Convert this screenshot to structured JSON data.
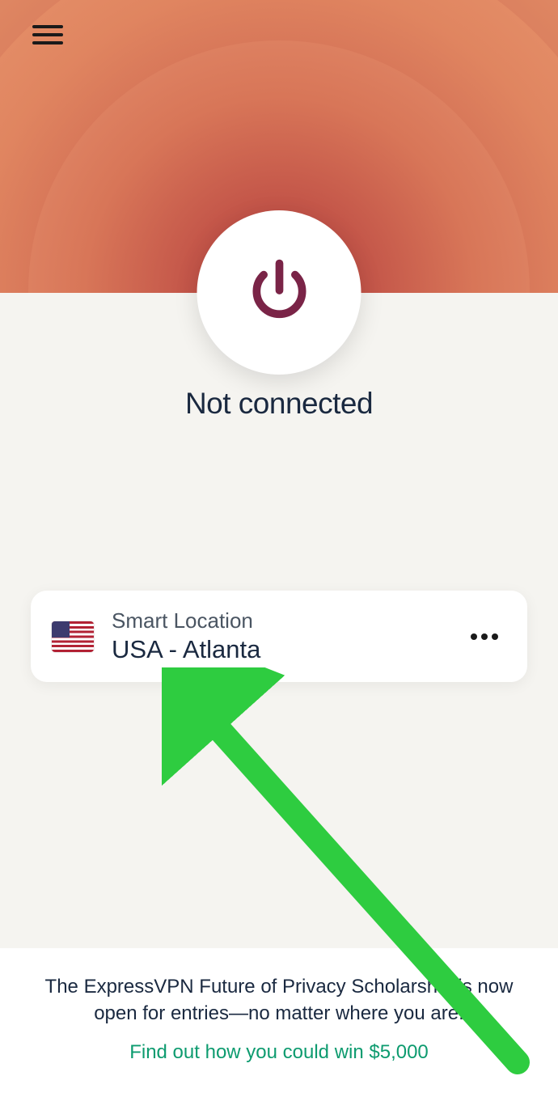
{
  "status": {
    "text": "Not connected"
  },
  "location": {
    "label": "Smart Location",
    "name": "USA - Atlanta",
    "flag_country": "usa"
  },
  "footer": {
    "message": "The ExpressVPN Future of Privacy Scholarship is now open for entries—no matter where you are.",
    "cta": "Find out how you could win $5,000"
  },
  "colors": {
    "accent": "#0d9b6f",
    "power_icon": "#7a2447",
    "arrow": "#2ecc40"
  }
}
